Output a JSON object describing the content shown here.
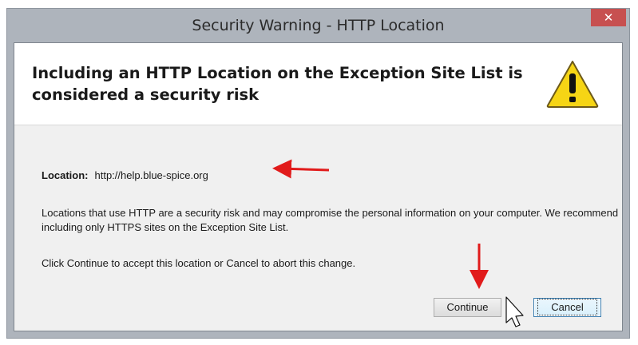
{
  "dialog": {
    "title": "Security Warning - HTTP Location",
    "close_label": "✕",
    "heading": "Including an HTTP Location on the Exception Site List is considered a security risk",
    "location_label": "Location:",
    "location_value": "http://help.blue-spice.org",
    "message": "Locations that use HTTP are a security risk and may compromise the personal information on your computer.  We recommend including only HTTPS sites on the Exception Site List.",
    "instruction": "Click Continue to accept this location or Cancel to abort this change.",
    "continue_label": "Continue",
    "cancel_label": "Cancel"
  },
  "colors": {
    "frame": "#aeb4bc",
    "close_button": "#c75050",
    "warning_yellow": "#f6d515",
    "annotation_arrow": "#e11b1b"
  },
  "icons": {
    "warning": "warning-triangle-icon",
    "cursor": "mouse-pointer-icon"
  }
}
